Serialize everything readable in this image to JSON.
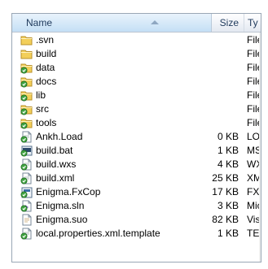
{
  "header": {
    "name": "Name",
    "size": "Size",
    "type": "Ty"
  },
  "rows": [
    {
      "name": ".svn",
      "size": "",
      "type": "File",
      "icon": "folder-icon"
    },
    {
      "name": "build",
      "size": "",
      "type": "File",
      "icon": "folder-icon"
    },
    {
      "name": "data",
      "size": "",
      "type": "File",
      "icon": "svn-folder-icon"
    },
    {
      "name": "docs",
      "size": "",
      "type": "File",
      "icon": "svn-folder-icon"
    },
    {
      "name": "lib",
      "size": "",
      "type": "File",
      "icon": "svn-folder-icon"
    },
    {
      "name": "src",
      "size": "",
      "type": "File",
      "icon": "svn-folder-icon"
    },
    {
      "name": "tools",
      "size": "",
      "type": "File",
      "icon": "svn-folder-icon"
    },
    {
      "name": "Ankh.Load",
      "size": "0 KB",
      "type": "LO",
      "icon": "svn-file-icon"
    },
    {
      "name": "build.bat",
      "size": "1 KB",
      "type": "MS",
      "icon": "svn-batch-file-icon"
    },
    {
      "name": "build.wxs",
      "size": "4 KB",
      "type": "WX",
      "icon": "svn-file-icon"
    },
    {
      "name": "build.xml",
      "size": "25 KB",
      "type": "XM",
      "icon": "svn-file-icon"
    },
    {
      "name": "Enigma.FxCop",
      "size": "17 KB",
      "type": "FX",
      "icon": "svn-fxcop-file-icon"
    },
    {
      "name": "Enigma.sln",
      "size": "3 KB",
      "type": "Mic",
      "icon": "svn-solution-file-icon"
    },
    {
      "name": "Enigma.suo",
      "size": "82 KB",
      "type": "Vis",
      "icon": "suo-file-icon"
    },
    {
      "name": "local.properties.xml.template",
      "size": "1 KB",
      "type": "TE",
      "icon": "svn-file-icon"
    }
  ],
  "colors": {
    "folder": "#f3cf5a",
    "svn_badge": "#3fa340",
    "header_text": "#1e395b"
  }
}
